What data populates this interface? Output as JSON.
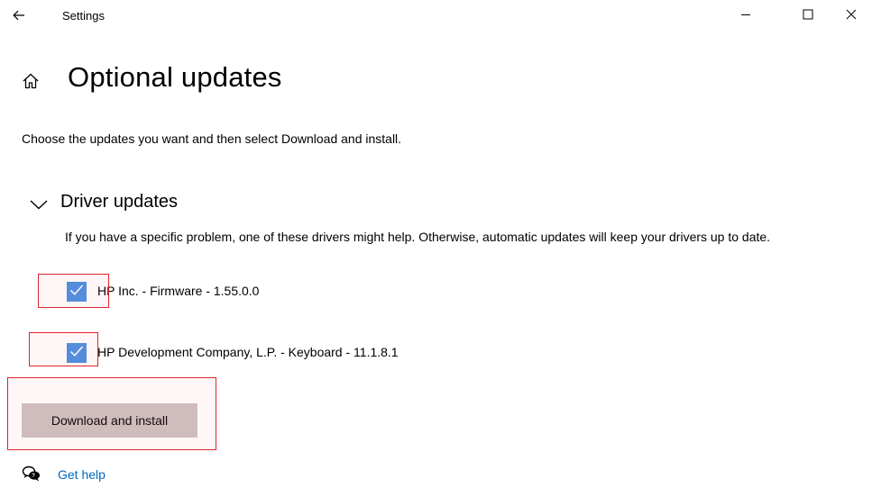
{
  "titlebar": {
    "back_icon": "back-arrow-icon",
    "app_title": "Settings",
    "minimize_icon": "minimize-icon",
    "maximize_icon": "maximize-icon",
    "close_icon": "close-icon"
  },
  "header": {
    "home_icon": "home-icon",
    "title": "Optional updates",
    "intro": "Choose the updates you want and then select Download and install."
  },
  "driver_updates": {
    "expanded": true,
    "title": "Driver updates",
    "description": "If you have a specific problem, one of these drivers might help. Otherwise, automatic updates will keep your drivers up to date.",
    "items": [
      {
        "label": "HP Inc. - Firmware - 1.55.0.0",
        "checked": true
      },
      {
        "label": "HP Development Company, L.P. - Keyboard - 11.1.8.1",
        "checked": true
      }
    ]
  },
  "actions": {
    "download_install_label": "Download and install"
  },
  "help": {
    "icon": "get-help-icon",
    "label": "Get help"
  },
  "colors": {
    "accent": "#4a90e2",
    "link": "#0067c0",
    "button_bg": "#ccbfc0",
    "highlight_border": "#e0242c"
  }
}
